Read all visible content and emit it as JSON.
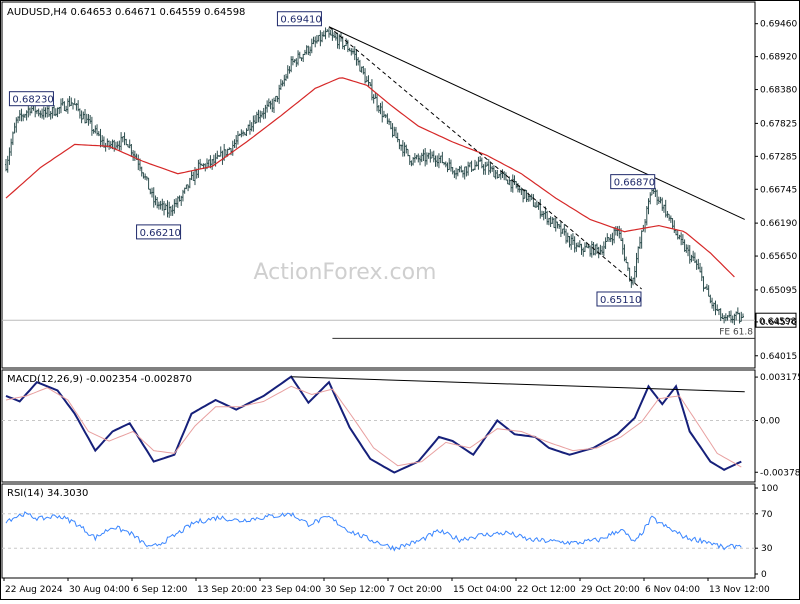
{
  "header": {
    "symbol_text": "AUDUSD,H4 0.64653 0.64671 0.64559 0.64598",
    "macd_text": "MACD(12,26,9) -0.002354 -0.002870",
    "rsi_text": "RSI(14) 34.3030"
  },
  "watermark": "ActionForex.com",
  "colors": {
    "candle": "#2f4f4f",
    "ma": "#d62828",
    "macd": "#16207a",
    "signal": "#e8a0a0",
    "rsi": "#3a86ff",
    "trend": "#000000",
    "grid": "#c8c8c8",
    "label_border": "#1f2a6b"
  },
  "chart_data": [
    {
      "type": "candlestick",
      "title": "AUDUSD,H4",
      "y_ticks": [
        0.64015,
        0.6457,
        0.65095,
        0.6565,
        0.6619,
        0.66745,
        0.67285,
        0.67825,
        0.6838,
        0.6892,
        0.6946
      ],
      "y_tick_labels": [
        "0.64015",
        "0.64570",
        "0.65095",
        "0.65650",
        "0.66190",
        "0.66745",
        "0.67285",
        "0.67825",
        "0.68380",
        "0.68920",
        "0.69460"
      ],
      "ylim": [
        0.6388,
        0.6975
      ],
      "x_tick_labels": [
        "22 Aug 2024",
        "30 Aug 04:00",
        "6 Sep 12:00",
        "13 Sep 20:00",
        "23 Sep 04:00",
        "30 Sep 12:00",
        "7 Oct 20:00",
        "15 Oct 04:00",
        "22 Oct 12:00",
        "29 Oct 20:00",
        "6 Nov 04:00",
        "13 Nov 12:00"
      ],
      "bar_count": 430,
      "price_path": [
        [
          0,
          0.6715
        ],
        [
          6,
          0.6785
        ],
        [
          14,
          0.6808
        ],
        [
          22,
          0.6798
        ],
        [
          30,
          0.6805
        ],
        [
          38,
          0.6818
        ],
        [
          46,
          0.679
        ],
        [
          58,
          0.6745
        ],
        [
          70,
          0.6755
        ],
        [
          78,
          0.6715
        ],
        [
          86,
          0.6655
        ],
        [
          94,
          0.6638
        ],
        [
          102,
          0.666
        ],
        [
          112,
          0.671
        ],
        [
          122,
          0.672
        ],
        [
          134,
          0.6752
        ],
        [
          146,
          0.6795
        ],
        [
          156,
          0.6815
        ],
        [
          166,
          0.688
        ],
        [
          176,
          0.6905
        ],
        [
          186,
          0.6928
        ],
        [
          194,
          0.6918
        ],
        [
          202,
          0.69
        ],
        [
          212,
          0.6838
        ],
        [
          224,
          0.6772
        ],
        [
          236,
          0.6722
        ],
        [
          250,
          0.6728
        ],
        [
          262,
          0.6705
        ],
        [
          276,
          0.6715
        ],
        [
          292,
          0.669
        ],
        [
          304,
          0.666
        ],
        [
          318,
          0.662
        ],
        [
          332,
          0.6578
        ],
        [
          346,
          0.6575
        ],
        [
          356,
          0.661
        ],
        [
          364,
          0.652
        ],
        [
          370,
          0.66
        ],
        [
          376,
          0.6675
        ],
        [
          382,
          0.665
        ],
        [
          392,
          0.659
        ],
        [
          402,
          0.655
        ],
        [
          410,
          0.649
        ],
        [
          418,
          0.6458
        ],
        [
          424,
          0.6466
        ],
        [
          429,
          0.646
        ]
      ],
      "ma_path": [
        [
          0,
          0.666
        ],
        [
          20,
          0.671
        ],
        [
          40,
          0.6748
        ],
        [
          60,
          0.6745
        ],
        [
          80,
          0.672
        ],
        [
          100,
          0.67
        ],
        [
          120,
          0.6712
        ],
        [
          140,
          0.6752
        ],
        [
          160,
          0.6795
        ],
        [
          180,
          0.684
        ],
        [
          195,
          0.6858
        ],
        [
          210,
          0.6845
        ],
        [
          225,
          0.681
        ],
        [
          240,
          0.6778
        ],
        [
          260,
          0.6752
        ],
        [
          280,
          0.673
        ],
        [
          300,
          0.67
        ],
        [
          320,
          0.666
        ],
        [
          340,
          0.6625
        ],
        [
          360,
          0.6605
        ],
        [
          380,
          0.6615
        ],
        [
          395,
          0.6605
        ],
        [
          410,
          0.657
        ],
        [
          425,
          0.6528
        ]
      ],
      "annotations": [
        {
          "label": "0.68230",
          "value": 0.6823
        },
        {
          "label": "0.66210",
          "value": 0.6621
        },
        {
          "label": "0.69410",
          "value": 0.6941
        },
        {
          "label": "0.66870",
          "value": 0.6687
        },
        {
          "label": "0.65110",
          "value": 0.6511
        },
        {
          "label": "0.64598",
          "value": 0.64598
        },
        {
          "label": "FE 61.8",
          "value": 0.643
        }
      ],
      "trendlines": [
        {
          "from": [
            188,
            0.6941
          ],
          "to": [
            430,
            0.6625
          ],
          "style": "solid"
        },
        {
          "from": [
            188,
            0.6941
          ],
          "to": [
            370,
            0.6511
          ],
          "style": "dashed"
        }
      ],
      "hlines": [
        {
          "value": 0.64598,
          "style": "solid",
          "color": "#bbbbbb"
        },
        {
          "value": 0.643,
          "style": "solid",
          "color": "#333333",
          "from_bar": 190
        }
      ],
      "grid": false
    },
    {
      "type": "line",
      "title": "MACD(12,26,9)",
      "y_tick_labels": [
        "0.003175",
        "0.00",
        "-0.00378"
      ],
      "y_ticks": [
        0.003175,
        0.0,
        -0.00378
      ],
      "ylim": [
        -0.0042,
        0.0034
      ],
      "series": [
        {
          "name": "MACD",
          "points": [
            [
              0,
              0.0018
            ],
            [
              8,
              0.0014
            ],
            [
              18,
              0.0028
            ],
            [
              30,
              0.0022
            ],
            [
              40,
              0.0005
            ],
            [
              52,
              -0.0022
            ],
            [
              62,
              -0.0008
            ],
            [
              72,
              -0.0002
            ],
            [
              86,
              -0.003
            ],
            [
              98,
              -0.0025
            ],
            [
              108,
              0.0005
            ],
            [
              122,
              0.0015
            ],
            [
              134,
              0.0008
            ],
            [
              150,
              0.0018
            ],
            [
              166,
              0.0032
            ],
            [
              176,
              0.0013
            ],
            [
              188,
              0.0028
            ],
            [
              200,
              -0.0005
            ],
            [
              212,
              -0.0028
            ],
            [
              226,
              -0.0038
            ],
            [
              240,
              -0.003
            ],
            [
              252,
              -0.0012
            ],
            [
              260,
              -0.0015
            ],
            [
              272,
              -0.0025
            ],
            [
              286,
              0.0
            ],
            [
              296,
              -0.001
            ],
            [
              308,
              -0.0012
            ],
            [
              316,
              -0.002
            ],
            [
              328,
              -0.0025
            ],
            [
              342,
              -0.002
            ],
            [
              356,
              -0.001
            ],
            [
              366,
              0.0002
            ],
            [
              374,
              0.0025
            ],
            [
              382,
              0.0012
            ],
            [
              390,
              0.0025
            ],
            [
              398,
              -0.0008
            ],
            [
              410,
              -0.003
            ],
            [
              418,
              -0.0036
            ],
            [
              428,
              -0.003
            ]
          ]
        },
        {
          "name": "Signal",
          "points": [
            [
              0,
              0.0015
            ],
            [
              12,
              0.0018
            ],
            [
              24,
              0.0024
            ],
            [
              36,
              0.0015
            ],
            [
              48,
              -0.0008
            ],
            [
              60,
              -0.0015
            ],
            [
              74,
              -0.0008
            ],
            [
              86,
              -0.0022
            ],
            [
              98,
              -0.0024
            ],
            [
              110,
              -0.0004
            ],
            [
              122,
              0.001
            ],
            [
              136,
              0.001
            ],
            [
              150,
              0.0014
            ],
            [
              166,
              0.0025
            ],
            [
              178,
              0.0019
            ],
            [
              190,
              0.0023
            ],
            [
              202,
              0.0002
            ],
            [
              214,
              -0.002
            ],
            [
              228,
              -0.0033
            ],
            [
              242,
              -0.003
            ],
            [
              256,
              -0.0016
            ],
            [
              270,
              -0.002
            ],
            [
              286,
              -0.0006
            ],
            [
              300,
              -0.0008
            ],
            [
              316,
              -0.0016
            ],
            [
              330,
              -0.0022
            ],
            [
              344,
              -0.002
            ],
            [
              358,
              -0.0012
            ],
            [
              370,
              -0.0001
            ],
            [
              380,
              0.0016
            ],
            [
              392,
              0.0018
            ],
            [
              402,
              -0.0001
            ],
            [
              414,
              -0.0024
            ],
            [
              428,
              -0.0034
            ]
          ]
        }
      ],
      "trendlines": [
        {
          "from": [
            166,
            0.0032
          ],
          "to": [
            430,
            0.0021
          ],
          "style": "solid"
        }
      ]
    },
    {
      "type": "line",
      "title": "RSI(14)",
      "y_tick_labels": [
        "100",
        "70",
        "30",
        "0"
      ],
      "y_ticks": [
        100,
        70,
        30,
        0
      ],
      "ylim": [
        0,
        100
      ],
      "series": [
        {
          "name": "RSI",
          "points": [
            [
              0,
              62
            ],
            [
              10,
              70
            ],
            [
              20,
              64
            ],
            [
              30,
              68
            ],
            [
              40,
              60
            ],
            [
              52,
              42
            ],
            [
              62,
              55
            ],
            [
              72,
              48
            ],
            [
              84,
              30
            ],
            [
              96,
              42
            ],
            [
              110,
              60
            ],
            [
              124,
              66
            ],
            [
              136,
              62
            ],
            [
              150,
              66
            ],
            [
              166,
              70
            ],
            [
              176,
              58
            ],
            [
              188,
              66
            ],
            [
              200,
              50
            ],
            [
              212,
              40
            ],
            [
              226,
              30
            ],
            [
              240,
              38
            ],
            [
              252,
              50
            ],
            [
              264,
              40
            ],
            [
              276,
              45
            ],
            [
              292,
              48
            ],
            [
              304,
              40
            ],
            [
              318,
              38
            ],
            [
              332,
              36
            ],
            [
              346,
              40
            ],
            [
              358,
              52
            ],
            [
              366,
              36
            ],
            [
              376,
              65
            ],
            [
              384,
              55
            ],
            [
              396,
              42
            ],
            [
              408,
              38
            ],
            [
              418,
              30
            ],
            [
              428,
              34
            ]
          ]
        }
      ],
      "hlines": [
        70,
        30
      ]
    }
  ]
}
